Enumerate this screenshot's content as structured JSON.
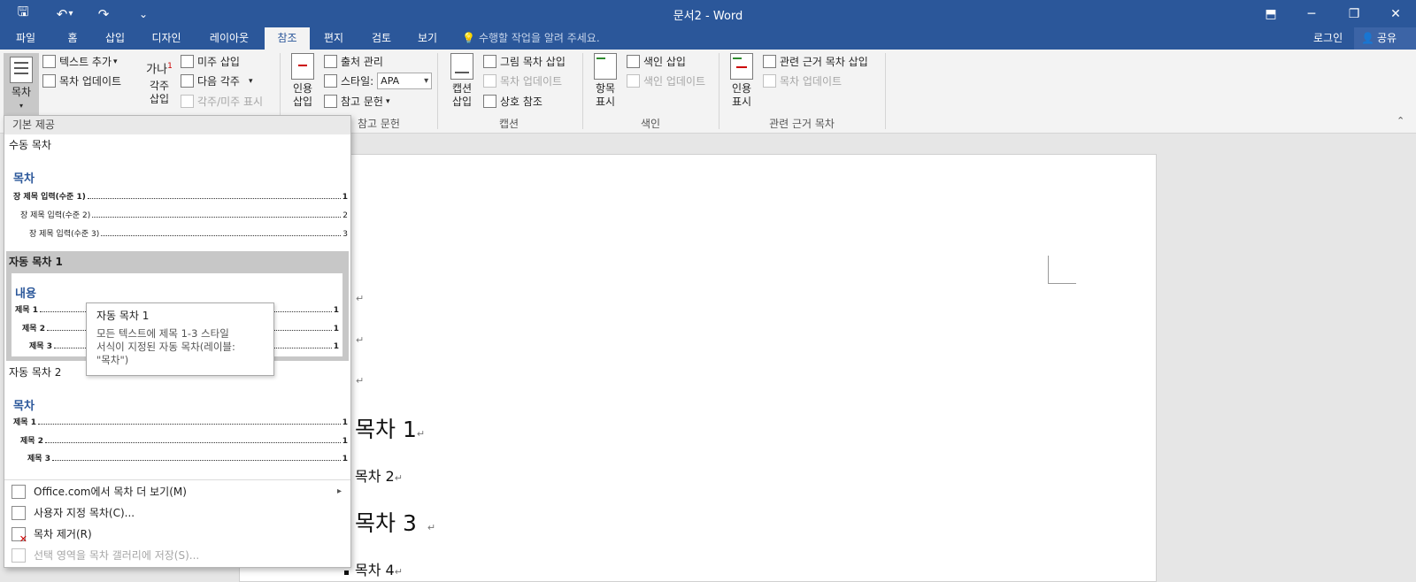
{
  "window": {
    "title": "문서2 - Word",
    "controls": {
      "ribbon_display": "⬒",
      "minimize": "─",
      "restore": "❐",
      "close": "✕"
    }
  },
  "quick_access": {
    "save": "🖫",
    "undo": "↶",
    "undo_more": "▾",
    "redo": "↷",
    "customize": "⌄"
  },
  "tabs": [
    {
      "label": "파일",
      "active": false
    },
    {
      "label": "홈",
      "active": false
    },
    {
      "label": "삽입",
      "active": false
    },
    {
      "label": "디자인",
      "active": false
    },
    {
      "label": "레이아웃",
      "active": false
    },
    {
      "label": "참조",
      "active": true
    },
    {
      "label": "편지",
      "active": false
    },
    {
      "label": "검토",
      "active": false
    },
    {
      "label": "보기",
      "active": false
    }
  ],
  "tell_me": "수행할 작업을 알려 주세요.",
  "login": "로그인",
  "share": "공유",
  "ribbon": {
    "toc": {
      "big_label": "목차",
      "add_text": "텍스트 추가",
      "update_toc": "목차 업데이트"
    },
    "footnotes": {
      "big_label_1": "각주",
      "big_label_2": "삽입",
      "big_icon_text": "가나",
      "sup": "1",
      "insert_endnote": "미주 삽입",
      "next_footnote": "다음 각주",
      "show_notes": "각주/미주 표시"
    },
    "citations": {
      "big_label_1": "인용",
      "big_label_2": "삽입",
      "manage_sources": "출처 관리",
      "style_label": "스타일:",
      "style_value": "APA",
      "bibliography": "참고 문헌",
      "group": "참고 문헌"
    },
    "captions": {
      "big_label_1": "캡션",
      "big_label_2": "삽입",
      "insert_tof": "그림 목차 삽입",
      "update_table": "목차 업데이트",
      "cross_ref": "상호 참조",
      "group": "캡션"
    },
    "index": {
      "big_label_1": "항목",
      "big_label_2": "표시",
      "insert_index": "색인 삽입",
      "update_index": "색인 업데이트",
      "group": "색인"
    },
    "authorities": {
      "big_label_1": "인용",
      "big_label_2": "표시",
      "insert_toa": "관련 근거 목차 삽입",
      "update_toa": "목차 업데이트",
      "group": "관련 근거 목차"
    },
    "collapse": "⌃"
  },
  "dropdown": {
    "section_builtin": "기본 제공",
    "manual": {
      "name": "수동 목차",
      "heading": "목차",
      "lines": [
        {
          "text": "장 제목 입력(수준 1)",
          "page": "1"
        },
        {
          "text": "장 제목 입력(수준 2)",
          "page": "2"
        },
        {
          "text": "장 제목 입력(수준 3)",
          "page": "3"
        }
      ]
    },
    "auto1": {
      "name": "자동 목차 1",
      "heading": "내용",
      "lines": [
        {
          "text": "제목 1",
          "page": "1"
        },
        {
          "text": "제목 2",
          "page": "1"
        },
        {
          "text": "제목 3",
          "page": "1"
        }
      ]
    },
    "auto2": {
      "name": "자동 목차 2",
      "heading": "목차",
      "lines": [
        {
          "text": "제목 1",
          "page": "1"
        },
        {
          "text": "제목 2",
          "page": "1"
        },
        {
          "text": "제목 3",
          "page": "1"
        }
      ]
    },
    "menu": [
      {
        "label": "Office.com에서 목차 더 보기(M)",
        "arrow": "▸",
        "enabled": true
      },
      {
        "label": "사용자 지정 목차(C)...",
        "enabled": true
      },
      {
        "label": "목차 제거(R)",
        "enabled": true
      },
      {
        "label": "선택 영역을 목차 갤러리에 저장(S)...",
        "enabled": false
      }
    ]
  },
  "tooltip": {
    "title": "자동 목차 1",
    "body_1": "모든 텍스트에 제목 1-3 스타일",
    "body_2": "서식이 지정된 자동 목차(레이블:",
    "body_3": "\"목차\")"
  },
  "document": {
    "para_mark": "↵",
    "headings": [
      {
        "text": "목차 1",
        "level": 1
      },
      {
        "text": "목차 2",
        "level": 2
      },
      {
        "text": "목차 3",
        "level": 1
      },
      {
        "text": "목차 4",
        "level": 2
      }
    ]
  }
}
